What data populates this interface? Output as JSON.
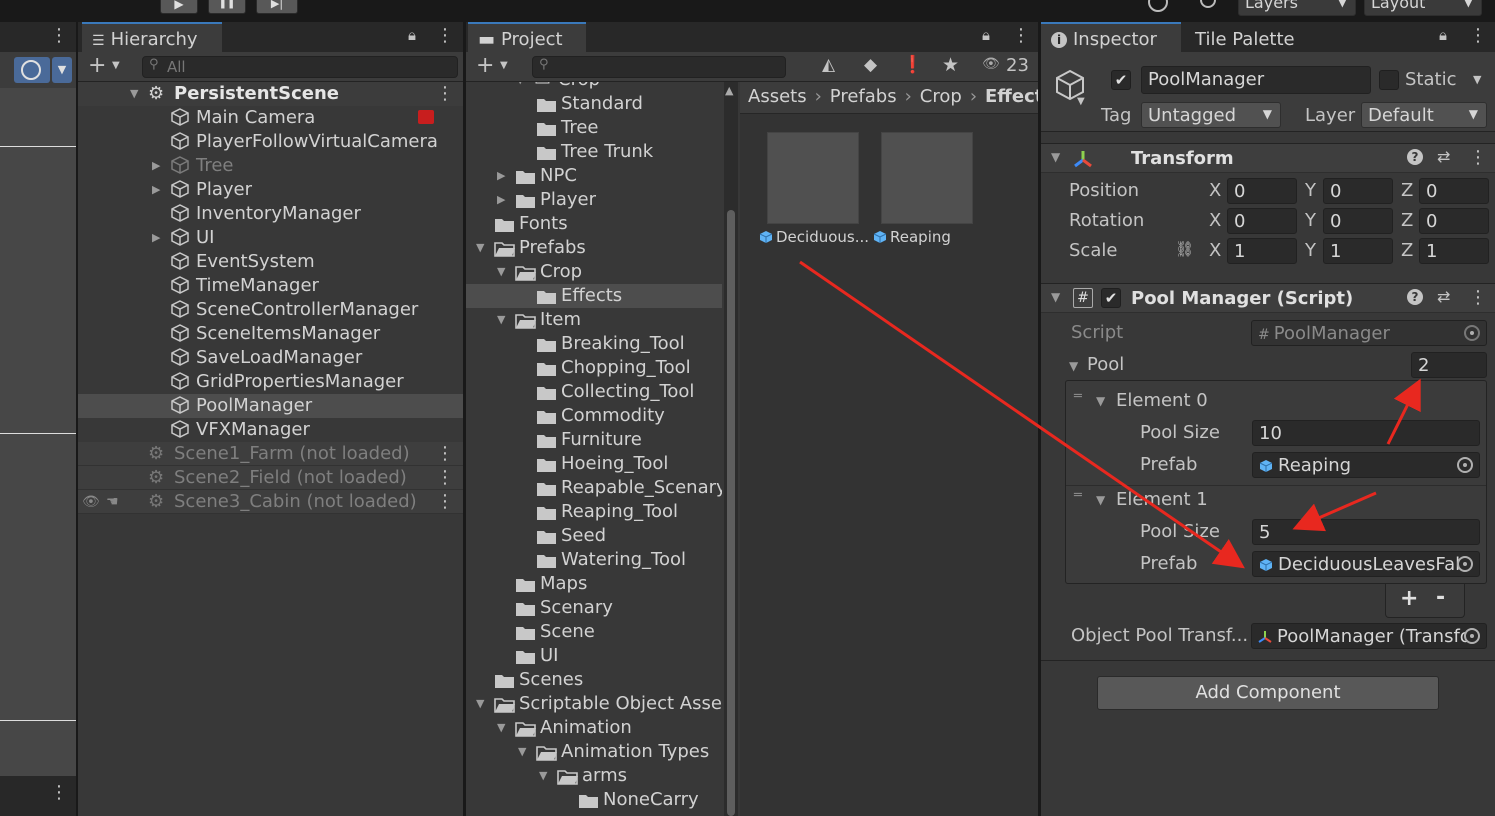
{
  "top_toolbar": {
    "play_icon": "▶",
    "pause_icon": "❚❚",
    "step_icon": "▶|",
    "layers_label": "Layers",
    "layout_label": "Layout"
  },
  "hierarchy": {
    "tab_label": "Hierarchy",
    "search_placeholder": "All",
    "scene_name": "PersistentScene",
    "items": [
      {
        "label": "Main Camera",
        "dim": false,
        "expandable": false
      },
      {
        "label": "PlayerFollowVirtualCamera",
        "dim": false,
        "expandable": false
      },
      {
        "label": "Tree",
        "dim": true,
        "expandable": true
      },
      {
        "label": "Player",
        "dim": false,
        "expandable": true
      },
      {
        "label": "InventoryManager",
        "dim": false,
        "expandable": false
      },
      {
        "label": "UI",
        "dim": false,
        "expandable": true
      },
      {
        "label": "EventSystem",
        "dim": false,
        "expandable": false
      },
      {
        "label": "TimeManager",
        "dim": false,
        "expandable": false
      },
      {
        "label": "SceneControllerManager",
        "dim": false,
        "expandable": false
      },
      {
        "label": "SceneItemsManager",
        "dim": false,
        "expandable": false
      },
      {
        "label": "SaveLoadManager",
        "dim": false,
        "expandable": false
      },
      {
        "label": "GridPropertiesManager",
        "dim": false,
        "expandable": false
      },
      {
        "label": "PoolManager",
        "dim": false,
        "expandable": false,
        "selected": true
      },
      {
        "label": "VFXManager",
        "dim": false,
        "expandable": false
      }
    ],
    "unloaded_scenes": [
      "Scene1_Farm (not loaded)",
      "Scene2_Field (not loaded)",
      "Scene3_Cabin (not loaded)"
    ]
  },
  "project": {
    "tab_label": "Project",
    "hidden_count": "23",
    "tree_top_partial": "Crop",
    "tree": [
      {
        "label": "Standard",
        "depth": 2
      },
      {
        "label": "Tree",
        "depth": 2
      },
      {
        "label": "Tree Trunk",
        "depth": 2
      },
      {
        "label": "NPC",
        "depth": 1,
        "arrow": "right"
      },
      {
        "label": "Player",
        "depth": 1,
        "arrow": "right"
      },
      {
        "label": "Fonts",
        "depth": 0
      },
      {
        "label": "Prefabs",
        "depth": 0,
        "arrow": "down",
        "open": true
      },
      {
        "label": "Crop",
        "depth": 1,
        "arrow": "down",
        "open": true
      },
      {
        "label": "Effects",
        "depth": 2,
        "selected": true
      },
      {
        "label": "Item",
        "depth": 1,
        "arrow": "down",
        "open": true
      },
      {
        "label": "Breaking_Tool",
        "depth": 2
      },
      {
        "label": "Chopping_Tool",
        "depth": 2
      },
      {
        "label": "Collecting_Tool",
        "depth": 2
      },
      {
        "label": "Commodity",
        "depth": 2
      },
      {
        "label": "Furniture",
        "depth": 2
      },
      {
        "label": "Hoeing_Tool",
        "depth": 2
      },
      {
        "label": "Reapable_Scenary",
        "depth": 2
      },
      {
        "label": "Reaping_Tool",
        "depth": 2
      },
      {
        "label": "Seed",
        "depth": 2
      },
      {
        "label": "Watering_Tool",
        "depth": 2
      },
      {
        "label": "Maps",
        "depth": 1
      },
      {
        "label": "Scenary",
        "depth": 1
      },
      {
        "label": "Scene",
        "depth": 1
      },
      {
        "label": "UI",
        "depth": 1
      },
      {
        "label": "Scenes",
        "depth": 0
      },
      {
        "label": "Scriptable Object Assets",
        "depth": 0,
        "arrow": "down",
        "open": true
      },
      {
        "label": "Animation",
        "depth": 1,
        "arrow": "down",
        "open": true
      },
      {
        "label": "Animation Types",
        "depth": 2,
        "arrow": "down",
        "open": true
      },
      {
        "label": "arms",
        "depth": 3,
        "arrow": "down",
        "open": true
      },
      {
        "label": "NoneCarry",
        "depth": 4
      }
    ],
    "breadcrumb": [
      "Assets",
      "Prefabs",
      "Crop",
      "Effects"
    ],
    "assets": [
      {
        "label": "Deciduous..."
      },
      {
        "label": "Reaping"
      }
    ]
  },
  "inspector": {
    "tab_label": "Inspector",
    "tab2_label": "Tile Palette",
    "object_name": "PoolManager",
    "static_label": "Static",
    "tag_label": "Tag",
    "tag_value": "Untagged",
    "layer_label": "Layer",
    "layer_value": "Default",
    "transform": {
      "title": "Transform",
      "position_label": "Position",
      "rotation_label": "Rotation",
      "scale_label": "Scale",
      "x": "X",
      "y": "Y",
      "z": "Z",
      "position": [
        "0",
        "0",
        "0"
      ],
      "rotation": [
        "0",
        "0",
        "0"
      ],
      "scale": [
        "1",
        "1",
        "1"
      ]
    },
    "pool_manager": {
      "title": "Pool Manager (Script)",
      "script_label": "Script",
      "script_value": "PoolManager",
      "pool_label": "Pool",
      "pool_size": "2",
      "element0_label": "Element 0",
      "element0_pool_size_label": "Pool Size",
      "element0_pool_size": "10",
      "element0_prefab_label": "Prefab",
      "element0_prefab": "Reaping",
      "element1_label": "Element 1",
      "element1_pool_size_label": "Pool Size",
      "element1_pool_size": "5",
      "element1_prefab_label": "Prefab",
      "element1_prefab": "DeciduousLeavesFal",
      "plus_label": "+",
      "minus_label": "-",
      "object_pool_label": "Object Pool Transf...",
      "object_pool_value": "PoolManager (Transfo"
    },
    "add_component_label": "Add Component"
  },
  "colors": {
    "selection": "#4d4d4d",
    "panel_bg": "#383838",
    "field_bg": "#2a2a2a",
    "annotation_red": "#e8281f",
    "prefab_blue": "#5fb3f5"
  }
}
